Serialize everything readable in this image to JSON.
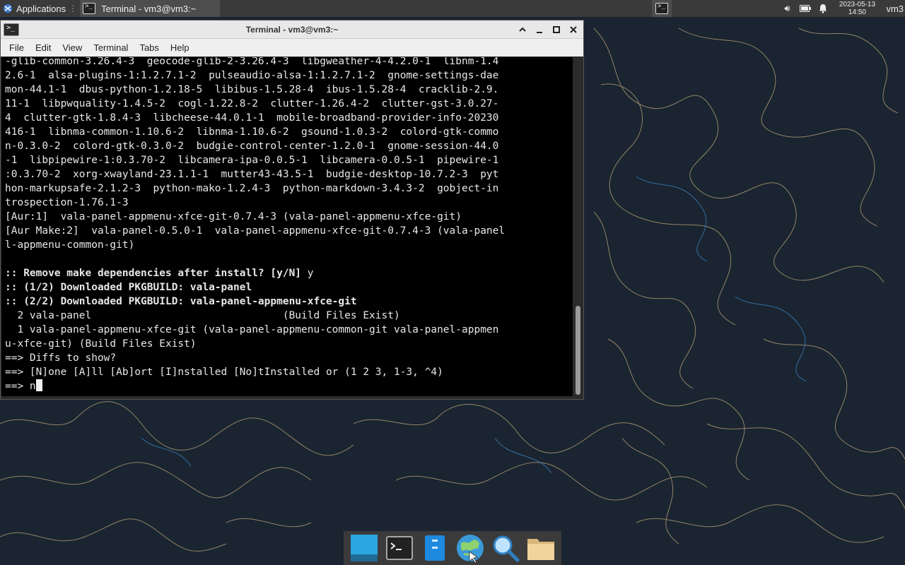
{
  "top_panel": {
    "apps_label": "Applications",
    "task_label": "Terminal - vm3@vm3:~",
    "clock_date": "2023-05-13",
    "clock_time": "14:50",
    "user_label": "vm3"
  },
  "window": {
    "title": "Terminal - vm3@vm3:~",
    "menu": [
      "File",
      "Edit",
      "View",
      "Terminal",
      "Tabs",
      "Help"
    ]
  },
  "terminal": {
    "lines": [
      {
        "text": "-glib-common-3.26.4-3  geocode-glib-2-3.26.4-3  libgweather-4-4.2.0-1  libnm-1.4",
        "bold": false
      },
      {
        "text": "2.6-1  alsa-plugins-1:1.2.7.1-2  pulseaudio-alsa-1:1.2.7.1-2  gnome-settings-dae",
        "bold": false
      },
      {
        "text": "mon-44.1-1  dbus-python-1.2.18-5  libibus-1.5.28-4  ibus-1.5.28-4  cracklib-2.9.",
        "bold": false
      },
      {
        "text": "11-1  libpwquality-1.4.5-2  cogl-1.22.8-2  clutter-1.26.4-2  clutter-gst-3.0.27-",
        "bold": false
      },
      {
        "text": "4  clutter-gtk-1.8.4-3  libcheese-44.0.1-1  mobile-broadband-provider-info-20230",
        "bold": false
      },
      {
        "text": "416-1  libnma-common-1.10.6-2  libnma-1.10.6-2  gsound-1.0.3-2  colord-gtk-commo",
        "bold": false
      },
      {
        "text": "n-0.3.0-2  colord-gtk-0.3.0-2  budgie-control-center-1.2.0-1  gnome-session-44.0",
        "bold": false
      },
      {
        "text": "-1  libpipewire-1:0.3.70-2  libcamera-ipa-0.0.5-1  libcamera-0.0.5-1  pipewire-1",
        "bold": false
      },
      {
        "text": ":0.3.70-2  xorg-xwayland-23.1.1-1  mutter43-43.5-1  budgie-desktop-10.7.2-3  pyt",
        "bold": false
      },
      {
        "text": "hon-markupsafe-2.1.2-3  python-mako-1.2.4-3  python-markdown-3.4.3-2  gobject-in",
        "bold": false
      },
      {
        "text": "trospection-1.76.1-3",
        "bold": false
      },
      {
        "text": "[Aur:1]  vala-panel-appmenu-xfce-git-0.7.4-3 (vala-panel-appmenu-xfce-git)",
        "bold": false
      },
      {
        "text": "[Aur Make:2]  vala-panel-0.5.0-1  vala-panel-appmenu-xfce-git-0.7.4-3 (vala-panel",
        "bold": false
      },
      {
        "text": "l-appmenu-common-git)",
        "bold": false
      },
      {
        "text": "",
        "bold": false
      },
      {
        "text": ":: Remove make dependencies after install? [y/N] ",
        "bold": true,
        "suffix": "y"
      },
      {
        "text": ":: (1/2) Downloaded PKGBUILD: vala-panel",
        "bold": true
      },
      {
        "text": ":: (2/2) Downloaded PKGBUILD: vala-panel-appmenu-xfce-git",
        "bold": true
      },
      {
        "text": "  2 vala-panel                               (Build Files Exist)",
        "bold": false
      },
      {
        "text": "  1 vala-panel-appmenu-xfce-git (vala-panel-appmenu-common-git vala-panel-appmen",
        "bold": false
      },
      {
        "text": "u-xfce-git) (Build Files Exist)",
        "bold": false
      },
      {
        "text": "==> Diffs to show?",
        "bold": false
      },
      {
        "text": "==> [N]one [A]ll [Ab]ort [I]nstalled [No]tInstalled or (1 2 3, 1-3, ^4)",
        "bold": false
      },
      {
        "text": "==> n",
        "bold": false,
        "cursor": true
      }
    ]
  },
  "dock": {
    "items": [
      "desktop-icon",
      "terminal-icon",
      "file-manager-icon",
      "web-browser-icon",
      "app-finder-icon",
      "folder-icon"
    ]
  }
}
